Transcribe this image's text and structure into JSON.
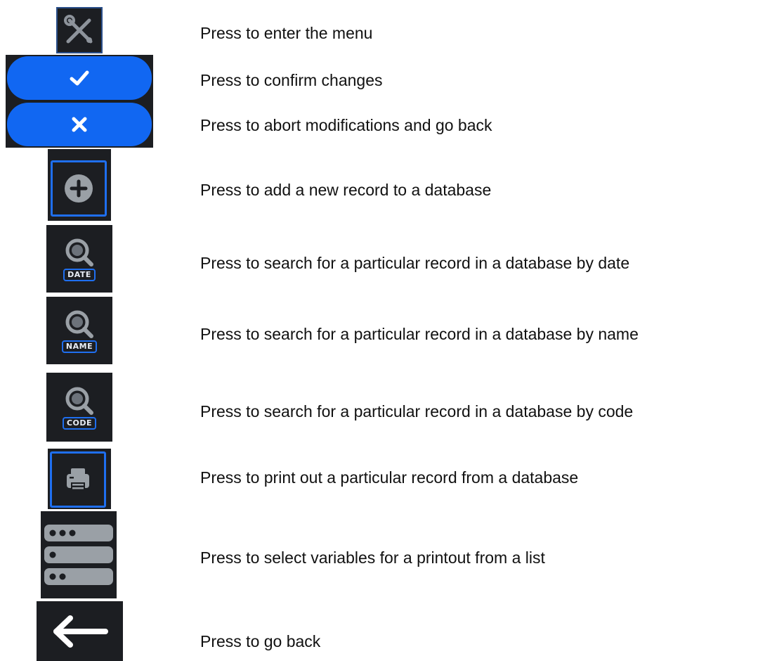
{
  "colors": {
    "tile_bg": "#1c1e22",
    "accent_blue": "#1167f2",
    "icon_gray": "#9aa0a6",
    "border_blue": "#1f6ff0"
  },
  "items": [
    {
      "icon": "tools-icon",
      "description": "Press to enter the menu"
    },
    {
      "icon": "check-icon",
      "description": "Press to confirm changes"
    },
    {
      "icon": "close-icon",
      "description": "Press to abort modifications and go back"
    },
    {
      "icon": "plus-icon",
      "description": "Press to add a new record to a database"
    },
    {
      "icon": "search-icon",
      "label": "DATE",
      "description": "Press to search for a particular record in a database by date"
    },
    {
      "icon": "search-icon",
      "label": "NAME",
      "description": "Press to search for a particular record in a database by name"
    },
    {
      "icon": "search-icon",
      "label": "CODE",
      "description": "Press to search for a particular record in a database by code"
    },
    {
      "icon": "printer-icon",
      "description": "Press to print out a particular record from a database"
    },
    {
      "icon": "list-icon",
      "description": "Press to select variables for a printout from a list"
    },
    {
      "icon": "arrow-left-icon",
      "description": "Press to go back"
    }
  ]
}
